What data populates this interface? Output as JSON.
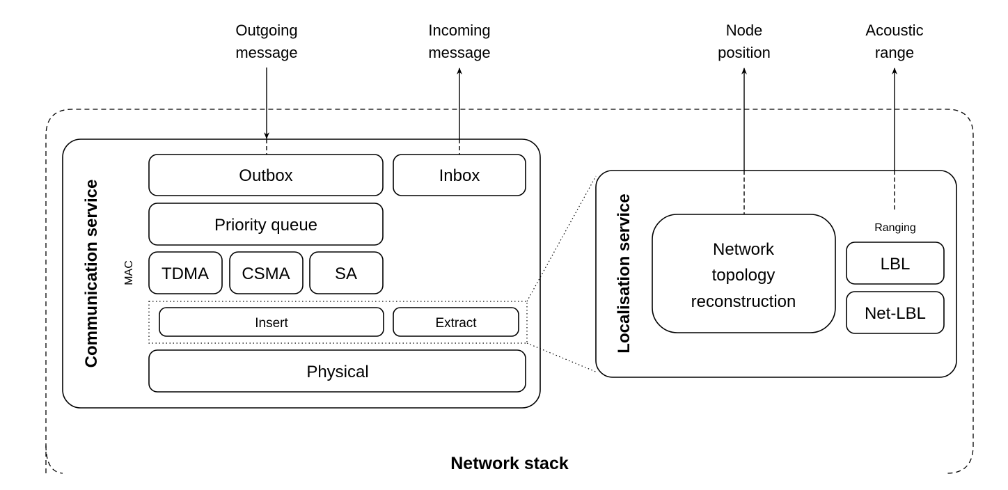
{
  "diagram": {
    "title": "Network stack",
    "outputs": {
      "outgoing": [
        "Outgoing",
        "message"
      ],
      "incoming": [
        "Incoming",
        "message"
      ],
      "node_position": [
        "Node",
        "position"
      ],
      "acoustic_range": [
        "Acoustic",
        "range"
      ]
    },
    "communication_service": {
      "title": "Communication service",
      "mac_label": "MAC",
      "outbox": "Outbox",
      "inbox": "Inbox",
      "priority_queue": "Priority queue",
      "mac_protocols": [
        "TDMA",
        "CSMA",
        "SA"
      ],
      "insert": "Insert",
      "extract": "Extract",
      "physical": "Physical"
    },
    "localisation_service": {
      "title": "Localisation service",
      "topology": [
        "Network",
        "topology",
        "reconstruction"
      ],
      "ranging_label": "Ranging",
      "ranging_methods": [
        "LBL",
        "Net-LBL"
      ]
    },
    "colors": {
      "stroke": "#000000",
      "background": "#ffffff"
    }
  }
}
